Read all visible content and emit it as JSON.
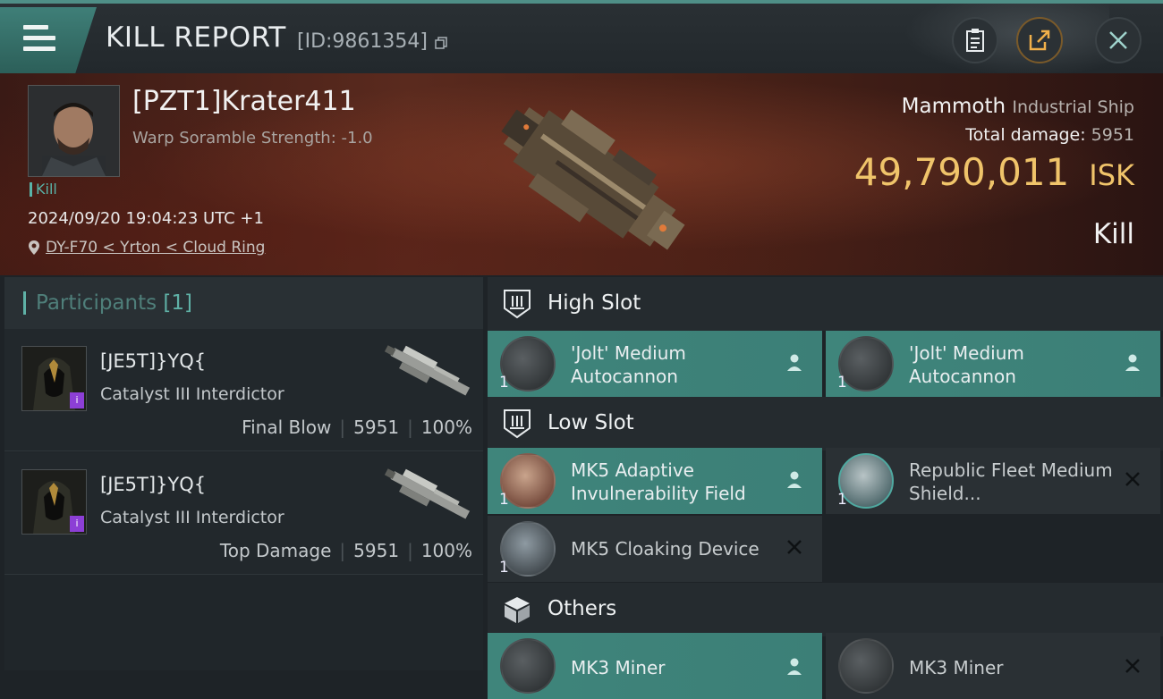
{
  "header": {
    "title": "KILL REPORT",
    "report_id": "[ID:9861354]",
    "buttons": [
      "clipboard-icon",
      "share-icon",
      "close-icon"
    ]
  },
  "victim": {
    "name": "[PZT1]Krater411",
    "scramble": "Warp Soramble Strength: -1.0",
    "kill_tag": "Kill",
    "datetime": "2024/09/20 19:04:23 UTC +1",
    "location": "DY-F70 < Yrton < Cloud Ring",
    "ship_name": "Mammoth",
    "ship_class": "Industrial Ship",
    "total_damage_label": "Total damage:",
    "total_damage": "5951",
    "isk_value": "49,790,011",
    "isk_unit": "ISK",
    "result": "Kill"
  },
  "participants": {
    "label": "Participants",
    "count": "[1]",
    "rows": [
      {
        "name": "[JE5T]}YQ{",
        "ship": "Catalyst III Interdictor",
        "role": "Final Blow",
        "damage": "5951",
        "percent": "100%"
      },
      {
        "name": "[JE5T]}YQ{",
        "ship": "Catalyst III Interdictor",
        "role": "Top Damage",
        "damage": "5951",
        "percent": "100%"
      }
    ]
  },
  "slots": {
    "high": {
      "label": "High Slot",
      "items": [
        {
          "name": "'Jolt' Medium Autocannon",
          "qty": "1",
          "state": "dropped"
        },
        {
          "name": "'Jolt' Medium Autocannon",
          "qty": "1",
          "state": "dropped"
        }
      ]
    },
    "low": {
      "label": "Low Slot",
      "items": [
        {
          "name": "MK5 Adaptive Invulnerability Field",
          "qty": "1",
          "state": "dropped"
        },
        {
          "name": "Republic Fleet Medium Shield...",
          "qty": "1",
          "state": "destroyed"
        },
        {
          "name": "MK5 Cloaking Device",
          "qty": "1",
          "state": "destroyed"
        }
      ]
    },
    "others": {
      "label": "Others",
      "items": [
        {
          "name": "MK3 Miner",
          "qty": "1",
          "state": "dropped"
        },
        {
          "name": "MK3 Miner",
          "qty": "1",
          "state": "destroyed"
        }
      ]
    }
  },
  "colors": {
    "accent": "#5fb1a6",
    "isk": "#f0c46a",
    "dropped_bg": "#3f857b",
    "destroyed_bg": "#2a3034"
  }
}
